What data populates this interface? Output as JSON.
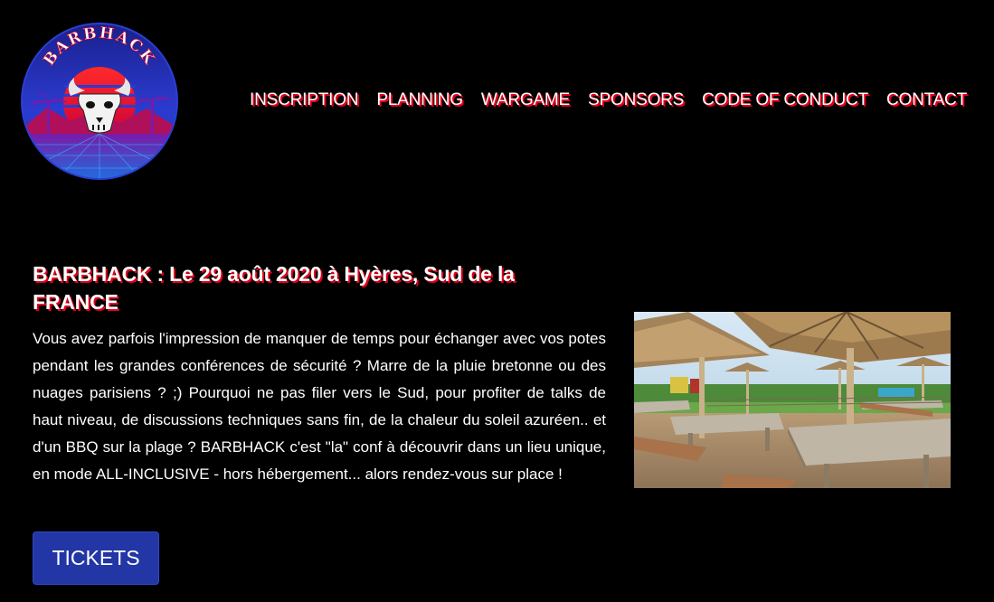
{
  "logo": {
    "text": "BARBHACK",
    "icon": "bull-skull-logo"
  },
  "nav": {
    "items": [
      {
        "label": "INSCRIPTION"
      },
      {
        "label": "PLANNING"
      },
      {
        "label": "WARGAME"
      },
      {
        "label": "SPONSORS"
      },
      {
        "label": "CODE OF CONDUCT"
      },
      {
        "label": "CONTACT"
      }
    ]
  },
  "hero": {
    "title": "BARBHACK : Le 29 août 2020 à Hyères, Sud de la FRANCE",
    "description": "Vous avez parfois l'impression de manquer de temps pour échanger avec vos potes pendant les grandes conférences de sécurité ? Marre de la pluie bretonne ou des nuages parisiens ? ;) Pourquoi ne pas filer vers le Sud, pour profiter de talks de haut niveau, de discussions techniques sans fin, de la chaleur du soleil azuréen.. et d'un BBQ sur la plage ? BARBHACK c'est \"la\" conf à découvrir dans un lieu unique, en mode ALL-INCLUSIVE - hors hébergement... alors rendez-vous sur place !",
    "tickets_label": "TICKETS"
  },
  "colors": {
    "background": "#000000",
    "accent_red": "#e1001b",
    "button_blue": "#2236a6"
  }
}
